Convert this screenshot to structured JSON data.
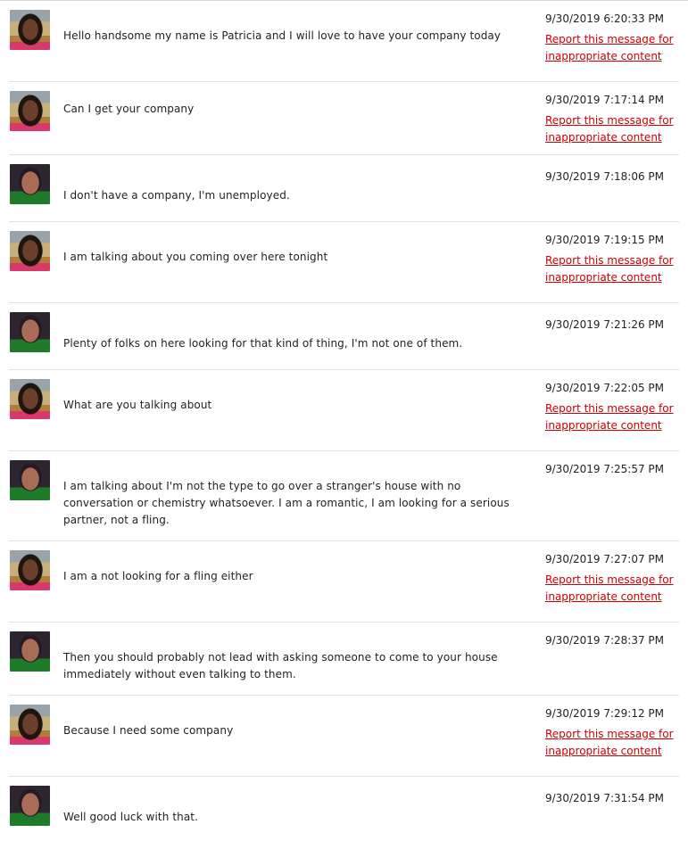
{
  "messages": [
    {
      "sender": "patricia",
      "avatar_icon": "woman-avatar-icon",
      "text": "Hello handsome my name is Patricia and I will love to have your company today",
      "timestamp": "9/30/2019 6:20:33 PM",
      "report_label": "Report this message for inappropriate content"
    },
    {
      "sender": "patricia",
      "avatar_icon": "woman-avatar-icon",
      "text": "Can I get your company",
      "timestamp": "9/30/2019 7:17:14 PM",
      "report_label": "Report this message for inappropriate content"
    },
    {
      "sender": "me",
      "avatar_icon": "man-avatar-icon",
      "text": "I don't have a company, I'm unemployed.",
      "timestamp": "9/30/2019 7:18:06 PM",
      "report_label": ""
    },
    {
      "sender": "patricia",
      "avatar_icon": "woman-avatar-icon",
      "text": "I am talking about you coming over here tonight",
      "timestamp": "9/30/2019 7:19:15 PM",
      "report_label": "Report this message for inappropriate content"
    },
    {
      "sender": "me",
      "avatar_icon": "man-avatar-icon",
      "text": "Plenty of folks on here looking for that kind of thing, I'm not one of them.",
      "timestamp": "9/30/2019 7:21:26 PM",
      "report_label": ""
    },
    {
      "sender": "patricia",
      "avatar_icon": "woman-avatar-icon",
      "text": "What are you talking about",
      "timestamp": "9/30/2019 7:22:05 PM",
      "report_label": "Report this message for inappropriate content"
    },
    {
      "sender": "me",
      "avatar_icon": "man-avatar-icon",
      "text": "I am talking about I'm not the type to go over a stranger's house with no conversation or chemistry whatsoever. I am a romantic, I am looking for a serious partner, not a fling.",
      "timestamp": "9/30/2019 7:25:57 PM",
      "report_label": ""
    },
    {
      "sender": "patricia",
      "avatar_icon": "woman-avatar-icon",
      "text": "I am a not looking for a fling either",
      "timestamp": "9/30/2019 7:27:07 PM",
      "report_label": "Report this message for inappropriate content"
    },
    {
      "sender": "me",
      "avatar_icon": "man-avatar-icon",
      "text": "Then you should probably not lead with asking someone to come to your house immediately without even talking to them.",
      "timestamp": "9/30/2019 7:28:37 PM",
      "report_label": ""
    },
    {
      "sender": "patricia",
      "avatar_icon": "woman-avatar-icon",
      "text": "Because I need some company",
      "timestamp": "9/30/2019 7:29:12 PM",
      "report_label": "Report this message for inappropriate content"
    },
    {
      "sender": "me",
      "avatar_icon": "man-avatar-icon",
      "text": "Well good luck with that.",
      "timestamp": "9/30/2019 7:31:54 PM",
      "report_label": ""
    }
  ]
}
